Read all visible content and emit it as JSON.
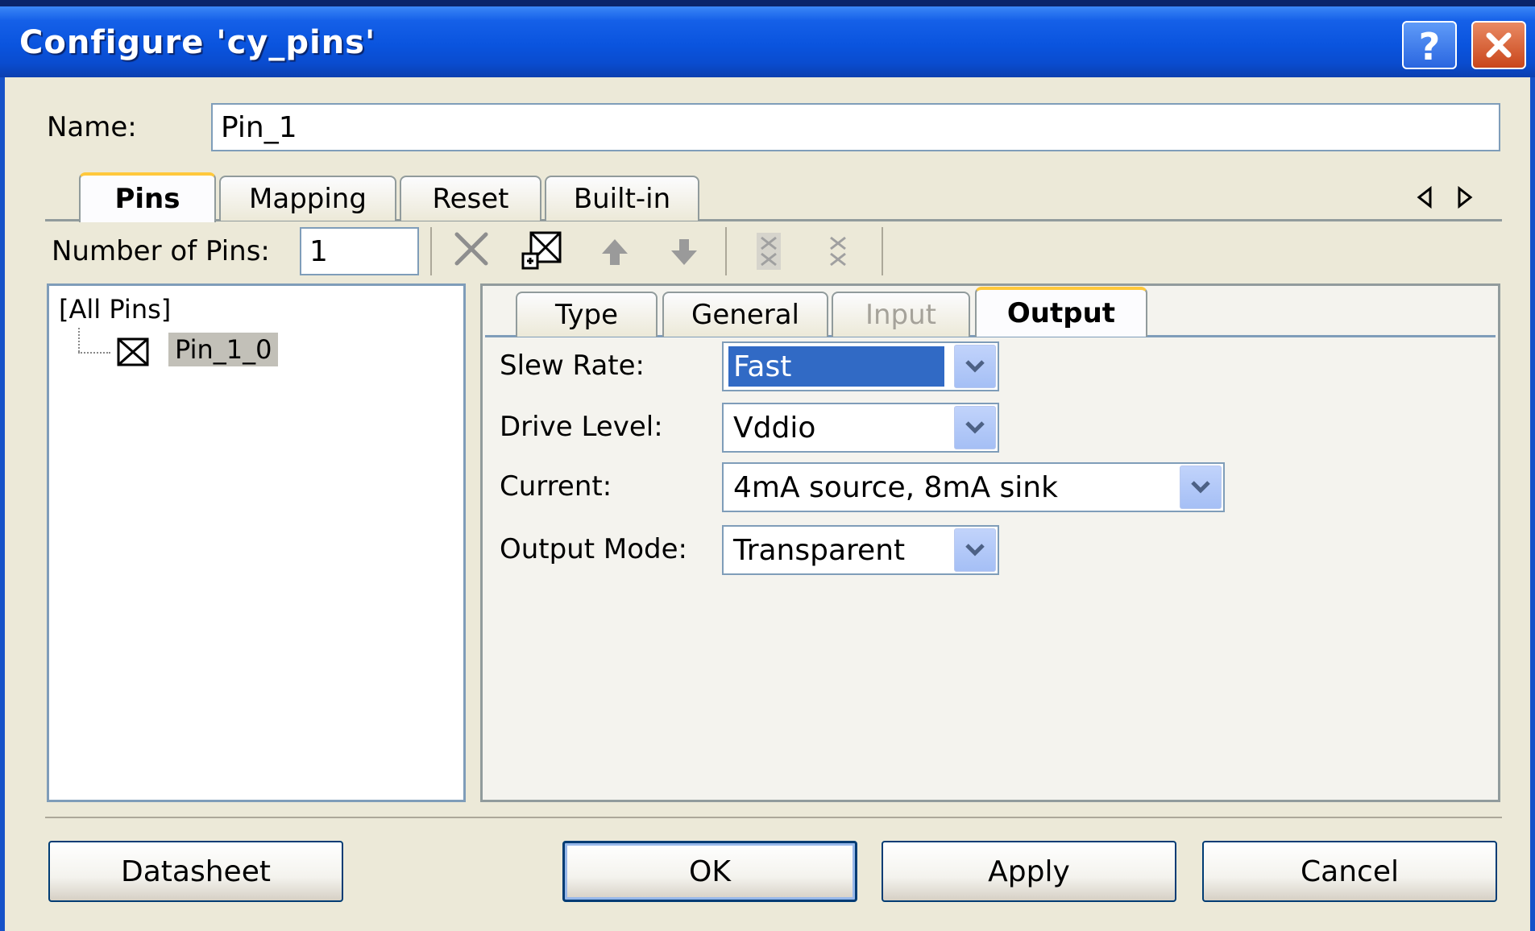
{
  "window": {
    "title": "Configure 'cy_pins'"
  },
  "name_field": {
    "label": "Name:",
    "value": "Pin_1"
  },
  "top_tabs": [
    {
      "label": "Pins",
      "active": true
    },
    {
      "label": "Mapping",
      "active": false
    },
    {
      "label": "Reset",
      "active": false
    },
    {
      "label": "Built-in",
      "active": false
    }
  ],
  "toolbar": {
    "num_pins_label": "Number of Pins:",
    "num_pins_value": "1",
    "icons": [
      "delete-icon",
      "add-pin-icon",
      "move-up-icon",
      "move-down-icon",
      "pair-icon",
      "unpair-icon"
    ]
  },
  "pin_tree": {
    "root": "[All Pins]",
    "items": [
      {
        "label": "Pin_1_0",
        "selected": true
      }
    ]
  },
  "sub_tabs": [
    {
      "label": "Type",
      "active": false,
      "disabled": false
    },
    {
      "label": "General",
      "active": false,
      "disabled": false
    },
    {
      "label": "Input",
      "active": false,
      "disabled": true
    },
    {
      "label": "Output",
      "active": true,
      "disabled": false
    }
  ],
  "output": {
    "slew_rate": {
      "label": "Slew Rate:",
      "value": "Fast"
    },
    "drive_level": {
      "label": "Drive Level:",
      "value": "Vddio"
    },
    "current": {
      "label": "Current:",
      "value": "4mA source, 8mA sink"
    },
    "output_mode": {
      "label": "Output Mode:",
      "value": "Transparent"
    }
  },
  "buttons": {
    "datasheet": "Datasheet",
    "ok": "OK",
    "apply": "Apply",
    "cancel": "Cancel"
  },
  "colors": {
    "titlebar": "#0a54de",
    "selection": "#316ac5",
    "dialog_bg": "#ece9d8"
  }
}
